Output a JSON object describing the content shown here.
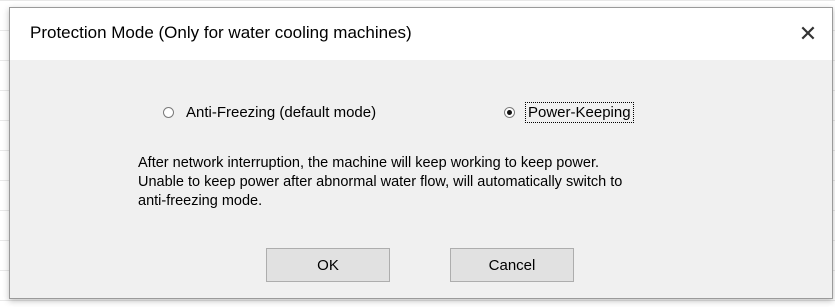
{
  "dialog": {
    "title": "Protection Mode (Only for water cooling machines)",
    "close_glyph": "✕",
    "close_icon": "close-icon"
  },
  "modes": {
    "anti_freezing_label": "Anti-Freezing (default mode)",
    "anti_freezing_selected": false,
    "power_keeping_label": "Power-Keeping",
    "power_keeping_selected": true
  },
  "description": {
    "line1": "After network interruption, the machine will keep working to keep power.",
    "line2": "Unable to keep power after abnormal water flow, will automatically switch to",
    "line3": "anti-freezing mode."
  },
  "buttons": {
    "ok_label": "OK",
    "cancel_label": "Cancel"
  }
}
